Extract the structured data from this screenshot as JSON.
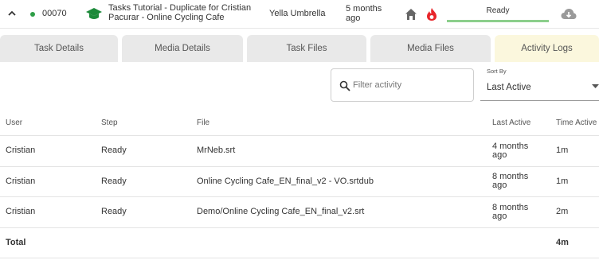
{
  "header": {
    "task_id": "00070",
    "task_title": "Tasks Tutorial - Duplicate for Cristian Pacurar - Online Cycling Cafe",
    "client": "Yella Umbrella",
    "updated": "5 months ago",
    "status": "Ready",
    "status_progress_percent": 100,
    "status_color": "#8ccf8c",
    "accent_fire": "#e8262b",
    "status_dot": "#2e9e47"
  },
  "tabs": [
    {
      "label": "Task Details"
    },
    {
      "label": "Media Details"
    },
    {
      "label": "Task Files"
    },
    {
      "label": "Media Files"
    },
    {
      "label": "Activity Logs"
    }
  ],
  "toolbar": {
    "filter_placeholder": "Filter activity",
    "sort_label": "Sort By",
    "sort_value": "Last Active"
  },
  "table": {
    "columns": [
      "User",
      "Step",
      "File",
      "Last Active",
      "Time Active"
    ],
    "rows": [
      {
        "user": "Cristian",
        "step": "Ready",
        "file": "MrNeb.srt",
        "last_active": "4 months ago",
        "time_active": "1m"
      },
      {
        "user": "Cristian",
        "step": "Ready",
        "file": "Online Cycling Cafe_EN_final_v2 - VO.srtdub",
        "last_active": "8 months ago",
        "time_active": "1m"
      },
      {
        "user": "Cristian",
        "step": "Ready",
        "file": "Demo/Online Cycling Cafe_EN_final_v2.srt",
        "last_active": "8 months ago",
        "time_active": "2m"
      }
    ],
    "total_label": "Total",
    "total_value": "4m"
  }
}
